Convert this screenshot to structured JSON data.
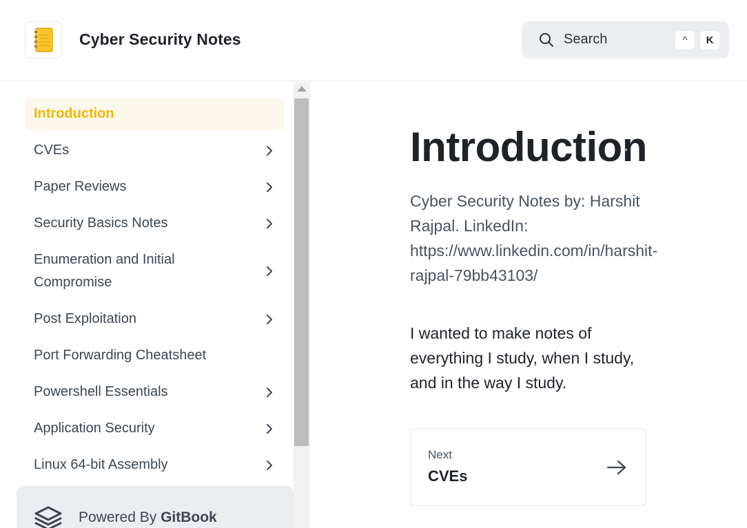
{
  "header": {
    "title": "Cyber Security Notes",
    "logo_icon": "notebook-icon",
    "search": {
      "label": "Search",
      "shortcut_modifier": "^",
      "shortcut_key": "K",
      "icon": "search-icon"
    }
  },
  "sidebar": {
    "items": [
      {
        "label": "Introduction",
        "active": true,
        "has_children": false
      },
      {
        "label": "CVEs",
        "has_children": true
      },
      {
        "label": "Paper Reviews",
        "has_children": true
      },
      {
        "label": "Security Basics Notes",
        "has_children": true
      },
      {
        "label": "Enumeration and Initial Compromise",
        "has_children": true
      },
      {
        "label": "Post Exploitation",
        "has_children": true
      },
      {
        "label": "Port Forwarding Cheatsheet",
        "has_children": false
      },
      {
        "label": "Powershell Essentials",
        "has_children": true
      },
      {
        "label": "Application Security",
        "has_children": true
      },
      {
        "label": "Linux 64-bit Assembly",
        "has_children": true
      }
    ],
    "powered_by": {
      "prefix": "Powered By ",
      "brand": "GitBook"
    }
  },
  "main": {
    "title": "Introduction",
    "description": "Cyber Security Notes by: Harshit Rajpal. LinkedIn: https://www.linkedin.com/in/harshit-rajpal-79bb43103/",
    "paragraph": "I wanted to make notes of everything I study, when I study, and in the way I study.",
    "next": {
      "kicker": "Next",
      "title": "CVEs"
    }
  },
  "colors": {
    "accent": "#f2b705",
    "active_bg": "#fdf8ec",
    "search_bg": "#ebedf0",
    "border": "#e6e8eb"
  }
}
